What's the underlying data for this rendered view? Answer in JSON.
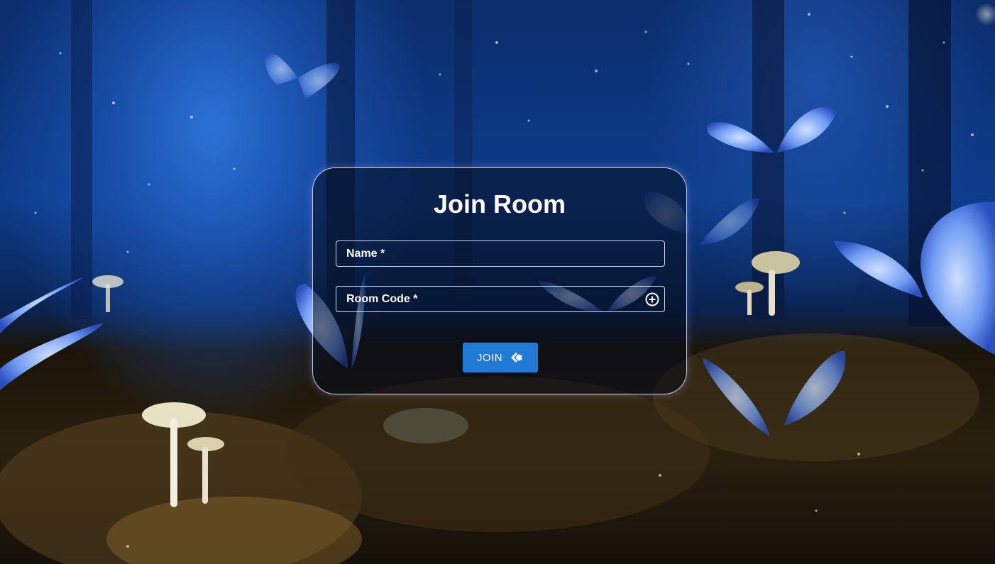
{
  "card": {
    "title": "Join Room"
  },
  "form": {
    "name_label": "Name *",
    "name_value": "",
    "room_code_label": "Room Code *",
    "room_code_value": "",
    "add_icon": "circle-plus-icon",
    "join_label": "JOIN",
    "join_icon": "handshake-icon"
  },
  "colors": {
    "accent": "#1f7ad6",
    "text": "#ffffff",
    "card_border": "#e6ebff"
  }
}
